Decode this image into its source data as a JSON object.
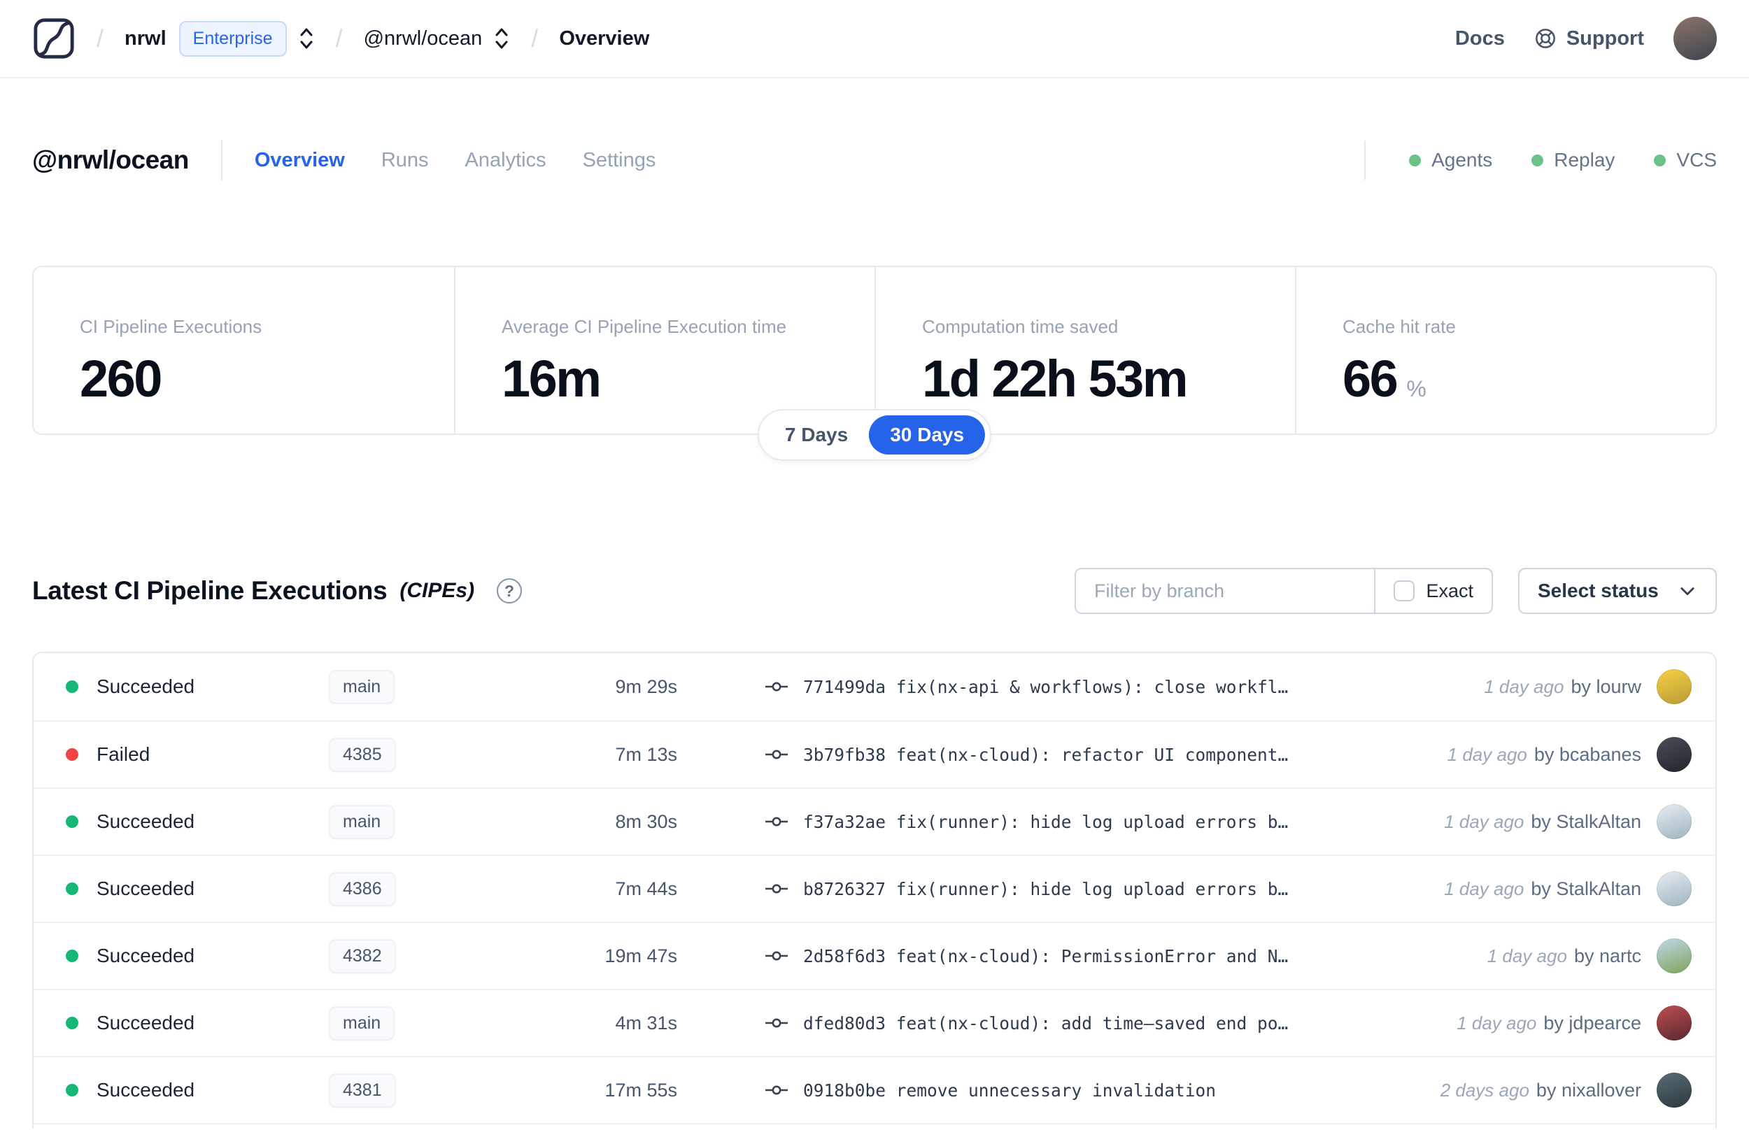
{
  "header": {
    "breadcrumb": {
      "org": "nrwl",
      "badge": "Enterprise",
      "workspace": "@nrwl/ocean",
      "page": "Overview"
    },
    "nav": {
      "docs": "Docs",
      "support": "Support"
    },
    "avatar_colors": [
      "#8d7468",
      "#3c4650"
    ]
  },
  "workspace": {
    "title": "@nrwl/ocean",
    "tabs": [
      {
        "label": "Overview",
        "active": true
      },
      {
        "label": "Runs",
        "active": false
      },
      {
        "label": "Analytics",
        "active": false
      },
      {
        "label": "Settings",
        "active": false
      }
    ],
    "features": [
      {
        "label": "Agents"
      },
      {
        "label": "Replay"
      },
      {
        "label": "VCS"
      }
    ],
    "feature_dot_color": "#6ac288"
  },
  "stats": {
    "cards": [
      {
        "label": "CI Pipeline Executions",
        "value": "260",
        "suffix": ""
      },
      {
        "label": "Average CI Pipeline Execution time",
        "value": "16m",
        "suffix": ""
      },
      {
        "label": "Computation time saved",
        "value": "1d 22h 53m",
        "suffix": ""
      },
      {
        "label": "Cache hit rate",
        "value": "66",
        "suffix": "%"
      }
    ],
    "range_toggle": {
      "options": [
        "7 Days",
        "30 Days"
      ],
      "selected": "30 Days"
    }
  },
  "cipe_section": {
    "title": "Latest CI Pipeline Executions",
    "title_suffix": "(CIPEs)",
    "filter_placeholder": "Filter by branch",
    "exact_label": "Exact",
    "status_select_label": "Select status",
    "rows": [
      {
        "status": "Succeeded",
        "status_color": "#17b877",
        "branch": "main",
        "duration": "9m 29s",
        "commit_hash": "771499da",
        "commit_message": "fix(nx-api & workflows): close workfl…",
        "time": "1 day ago",
        "author": "by lourw",
        "avatar_colors": [
          "#f7d046",
          "#b99a35"
        ]
      },
      {
        "status": "Failed",
        "status_color": "#ef4444",
        "branch": "4385",
        "duration": "7m 13s",
        "commit_hash": "3b79fb38",
        "commit_message": "feat(nx-cloud): refactor UI component…",
        "time": "1 day ago",
        "author": "by bcabanes",
        "avatar_colors": [
          "#4a4e59",
          "#23252c"
        ]
      },
      {
        "status": "Succeeded",
        "status_color": "#17b877",
        "branch": "main",
        "duration": "8m 30s",
        "commit_hash": "f37a32ae",
        "commit_message": "fix(runner): hide log upload errors b…",
        "time": "1 day ago",
        "author": "by StalkAltan",
        "avatar_colors": [
          "#e8eef2",
          "#9fb3c0"
        ]
      },
      {
        "status": "Succeeded",
        "status_color": "#17b877",
        "branch": "4386",
        "duration": "7m 44s",
        "commit_hash": "b8726327",
        "commit_message": "fix(runner): hide log upload errors b…",
        "time": "1 day ago",
        "author": "by StalkAltan",
        "avatar_colors": [
          "#e8eef2",
          "#9fb3c0"
        ]
      },
      {
        "status": "Succeeded",
        "status_color": "#17b877",
        "branch": "4382",
        "duration": "19m 47s",
        "commit_hash": "2d58f6d3",
        "commit_message": "feat(nx-cloud): PermissionError and N…",
        "time": "1 day ago",
        "author": "by nartc",
        "avatar_colors": [
          "#bfd9ea",
          "#7fa35a"
        ]
      },
      {
        "status": "Succeeded",
        "status_color": "#17b877",
        "branch": "main",
        "duration": "4m 31s",
        "commit_hash": "dfed80d3",
        "commit_message": "feat(nx-cloud): add time–saved end po…",
        "time": "1 day ago",
        "author": "by jdpearce",
        "avatar_colors": [
          "#c05050",
          "#57282f"
        ]
      },
      {
        "status": "Succeeded",
        "status_color": "#17b877",
        "branch": "4381",
        "duration": "17m 55s",
        "commit_hash": "0918b0be",
        "commit_message": "remove unnecessary invalidation",
        "time": "2 days ago",
        "author": "by nixallover",
        "avatar_colors": [
          "#5a6e76",
          "#2c373d"
        ]
      }
    ]
  },
  "colors": {
    "accent_blue": "#2563eb",
    "success_green": "#17b877",
    "fail_red": "#ef4444"
  }
}
